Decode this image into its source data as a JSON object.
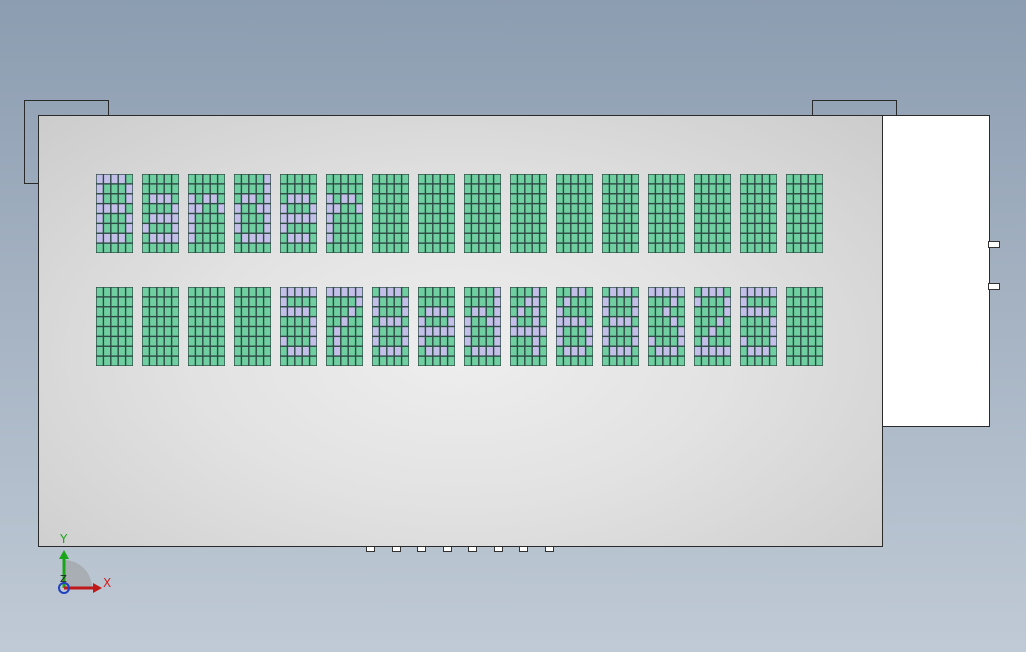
{
  "viewport": {
    "axes": {
      "x_label": "X",
      "y_label": "Y",
      "z_label": "Z"
    }
  },
  "lcd": {
    "rows": 2,
    "cols": 16,
    "cell_cols": 5,
    "cell_rows": 8,
    "line1_chars": [
      "B",
      "a",
      "r",
      "d",
      "e",
      "r",
      "",
      "",
      "",
      "",
      "",
      "",
      "",
      "",
      "",
      ""
    ],
    "line2_chars": [
      "",
      "",
      "",
      "",
      "5",
      "7",
      "8",
      "e",
      "d",
      "4",
      "6",
      "8",
      "3",
      "2",
      "5",
      ""
    ]
  },
  "colors": {
    "pixel_off": "#6fcfa0",
    "pixel_on": "#c4bfe8",
    "grid_line": "#2e4a45",
    "axis_x": "#d02020",
    "axis_y": "#1aa51a",
    "axis_z": "#2040c0"
  }
}
